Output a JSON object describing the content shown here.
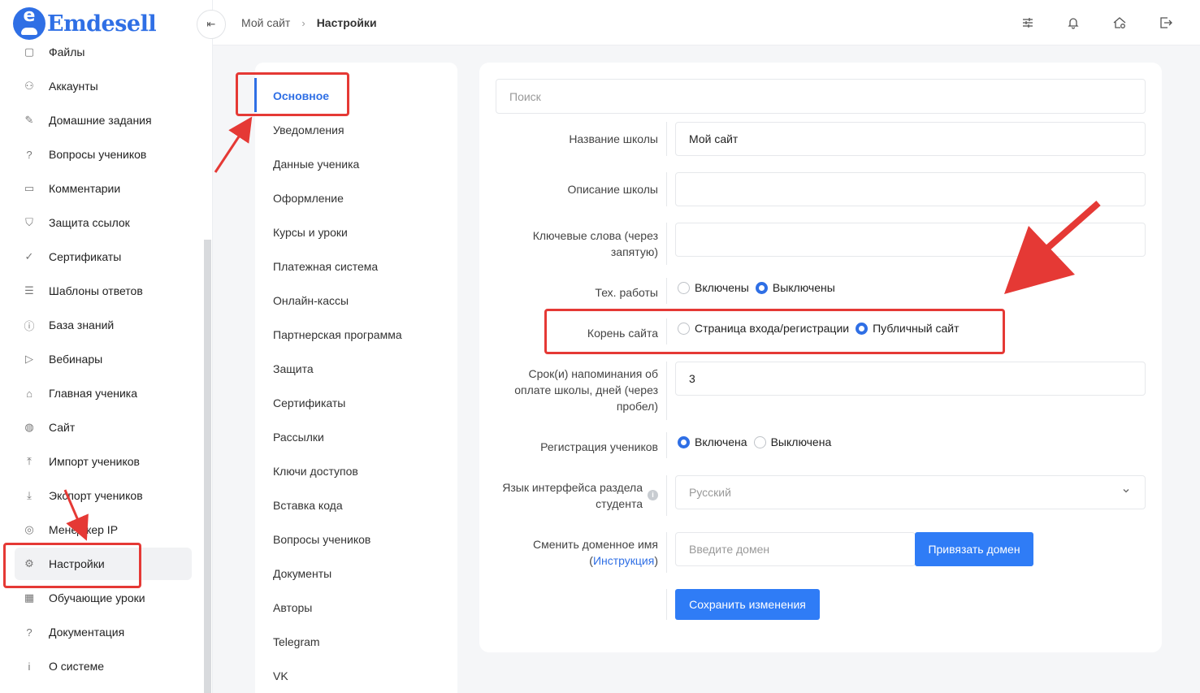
{
  "brand": {
    "name": "Emdesell",
    "badge_letter": "e",
    "color": "#2f6fe5"
  },
  "sidebar": {
    "items": [
      {
        "label": "Файлы",
        "icon": "file-icon"
      },
      {
        "label": "Аккаунты",
        "icon": "users-icon"
      },
      {
        "label": "Домашние задания",
        "icon": "pencil-icon"
      },
      {
        "label": "Вопросы учеников",
        "icon": "question-circle-icon"
      },
      {
        "label": "Комментарии",
        "icon": "comment-icon"
      },
      {
        "label": "Защита ссылок",
        "icon": "shield-icon"
      },
      {
        "label": "Сертификаты",
        "icon": "check-badge-icon"
      },
      {
        "label": "Шаблоны ответов",
        "icon": "list-icon"
      },
      {
        "label": "База знаний",
        "icon": "info-circle-icon"
      },
      {
        "label": "Вебинары",
        "icon": "play-icon"
      },
      {
        "label": "Главная ученика",
        "icon": "home-icon"
      },
      {
        "label": "Сайт",
        "icon": "globe-icon"
      },
      {
        "label": "Импорт учеников",
        "icon": "upload-icon"
      },
      {
        "label": "Экспорт учеников",
        "icon": "download-icon"
      },
      {
        "label": "Менеджер IP",
        "icon": "target-icon"
      },
      {
        "label": "Настройки",
        "icon": "gear-icon",
        "active": true
      },
      {
        "label": "Обучающие уроки",
        "icon": "film-icon"
      },
      {
        "label": "Документация",
        "icon": "help-square-icon"
      },
      {
        "label": "О системе",
        "icon": "info-square-icon"
      }
    ]
  },
  "topbar": {
    "collapse_icon": "collapse-left-icon",
    "breadcrumb": {
      "root": "Мой сайт",
      "separator": "›",
      "current": "Настройки"
    },
    "icons": [
      "sliders-icon",
      "bell-icon",
      "home-settings-icon",
      "logout-icon"
    ]
  },
  "settings_menu": {
    "items": [
      {
        "label": "Основное",
        "active": true
      },
      {
        "label": "Уведомления"
      },
      {
        "label": "Данные ученика"
      },
      {
        "label": "Оформление"
      },
      {
        "label": "Курсы и уроки"
      },
      {
        "label": "Платежная система"
      },
      {
        "label": "Онлайн-кассы"
      },
      {
        "label": "Партнерская программа"
      },
      {
        "label": "Защита"
      },
      {
        "label": "Сертификаты"
      },
      {
        "label": "Рассылки"
      },
      {
        "label": "Ключи доступов"
      },
      {
        "label": "Вставка кода"
      },
      {
        "label": "Вопросы учеников"
      },
      {
        "label": "Документы"
      },
      {
        "label": "Авторы"
      },
      {
        "label": "Telegram"
      },
      {
        "label": "VK"
      }
    ]
  },
  "form": {
    "search_placeholder": "Поиск",
    "school_name": {
      "label": "Название школы",
      "value": "Мой сайт"
    },
    "school_description": {
      "label": "Описание школы",
      "value": ""
    },
    "keywords": {
      "label_line1": "Ключевые слова (через",
      "label_line2": "запятую)",
      "value": ""
    },
    "maintenance": {
      "label": "Тех. работы",
      "options": [
        "Включены",
        "Выключены"
      ],
      "selected": 1
    },
    "site_root": {
      "label": "Корень сайта",
      "options": [
        "Страница входа/регистрации",
        "Публичный сайт"
      ],
      "selected": 1
    },
    "reminder": {
      "label_line1": "Срок(и) напоминания об",
      "label_line2": "оплате школы, дней (через",
      "label_line3": "пробел)",
      "value": "3"
    },
    "registration": {
      "label": "Регистрация учеников",
      "options": [
        "Включена",
        "Выключена"
      ],
      "selected": 0
    },
    "language": {
      "label_line1": "Язык интерфейса раздела",
      "label_line2": "студента",
      "info": "i",
      "value": "Русский"
    },
    "domain": {
      "label_line1": "Сменить доменное имя",
      "link_open": "(",
      "link_text": "Инструкция",
      "link_close": ")",
      "placeholder": "Введите домен",
      "bind_button": "Привязать домен"
    },
    "save_button": "Сохранить изменения"
  },
  "colors": {
    "accent": "#2f6fe5",
    "button": "#2f7cf6",
    "annotation": "#e53935"
  }
}
